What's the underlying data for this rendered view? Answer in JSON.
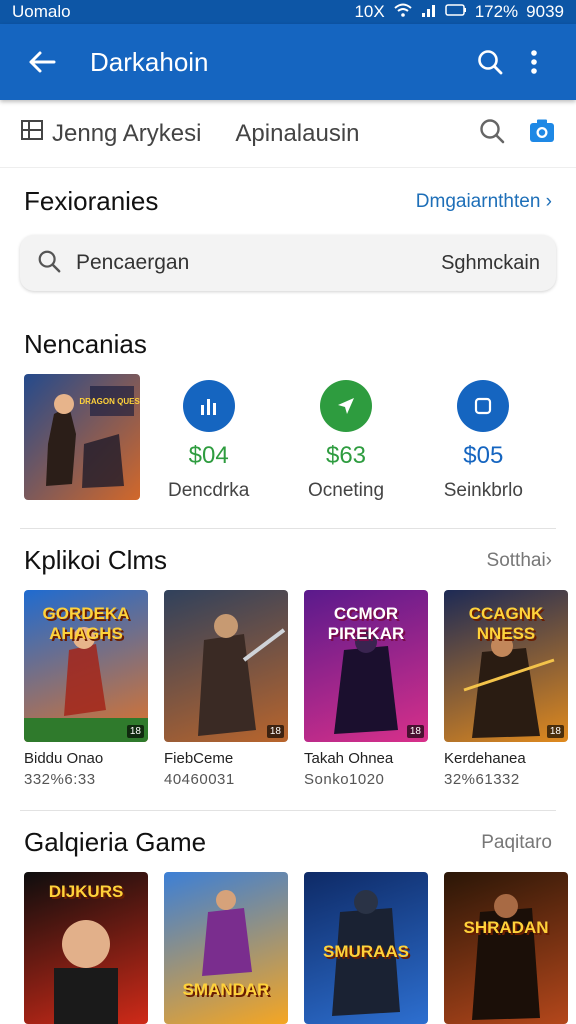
{
  "status": {
    "carrier": "Uomalo",
    "signal_text": "10X",
    "battery": "172%",
    "time": "9039"
  },
  "app_bar": {
    "title": "Darkahoin"
  },
  "tabs": [
    {
      "label": "Jenng Arykesi"
    },
    {
      "label": "Apinalausin"
    }
  ],
  "recent": {
    "title": "Fexioranies",
    "link": "Dmgaiarnthten ›"
  },
  "search": {
    "placeholder": "Pencaergan",
    "right_label": "Sghmckain"
  },
  "recommendations": {
    "title": "Nencanias",
    "thumb_title": "DRAGON QUEST",
    "items": [
      {
        "price": "$04",
        "label": "Dencdrka",
        "color": "#1565c0",
        "price_color": "#2e9c3f",
        "icon": "bar-chart-icon"
      },
      {
        "price": "$63",
        "label": "Ocneting",
        "color": "#2e9c3f",
        "price_color": "#2e9c3f",
        "icon": "location-arrow-icon"
      },
      {
        "price": "$05",
        "label": "Seinkbrlo",
        "color": "#1565c0",
        "price_color": "#1565c0",
        "icon": "square-icon"
      }
    ]
  },
  "games_section": {
    "title": "Kplikoi Clms",
    "link": "Sotthai›",
    "items": [
      {
        "name": "Biddu Onao",
        "meta": "332%6:33",
        "art_title": "GORDEKA AHAGHS",
        "bg1": "#1f6bd0",
        "bg2": "#e0742a"
      },
      {
        "name": "FiebCeme",
        "meta": "40460031",
        "art_title": "",
        "bg1": "#30415c",
        "bg2": "#b9652c"
      },
      {
        "name": "Takah Ohnea",
        "meta": "Sonko1020",
        "art_title": "CCMOR PIREKAR",
        "bg1": "#5a1a8c",
        "bg2": "#d8308a"
      },
      {
        "name": "Kerdehanea",
        "meta": "32%61332",
        "art_title": "CCAGNK NNESS",
        "bg1": "#1d2a55",
        "bg2": "#e08a1e"
      }
    ]
  },
  "gallery_section": {
    "title": "Galqieria Game",
    "link": "Paqitaro",
    "items": [
      {
        "art_title": "DIJKURS",
        "bg1": "#0d0d0d",
        "bg2": "#cf2a18"
      },
      {
        "art_title": "SMANDAR",
        "bg1": "#3c7fd6",
        "bg2": "#f5a623"
      },
      {
        "art_title": "SMURAAS",
        "bg1": "#0e2a66",
        "bg2": "#2d6fd0"
      },
      {
        "art_title": "SHRADAN",
        "bg1": "#2a1607",
        "bg2": "#b4471b"
      }
    ]
  }
}
